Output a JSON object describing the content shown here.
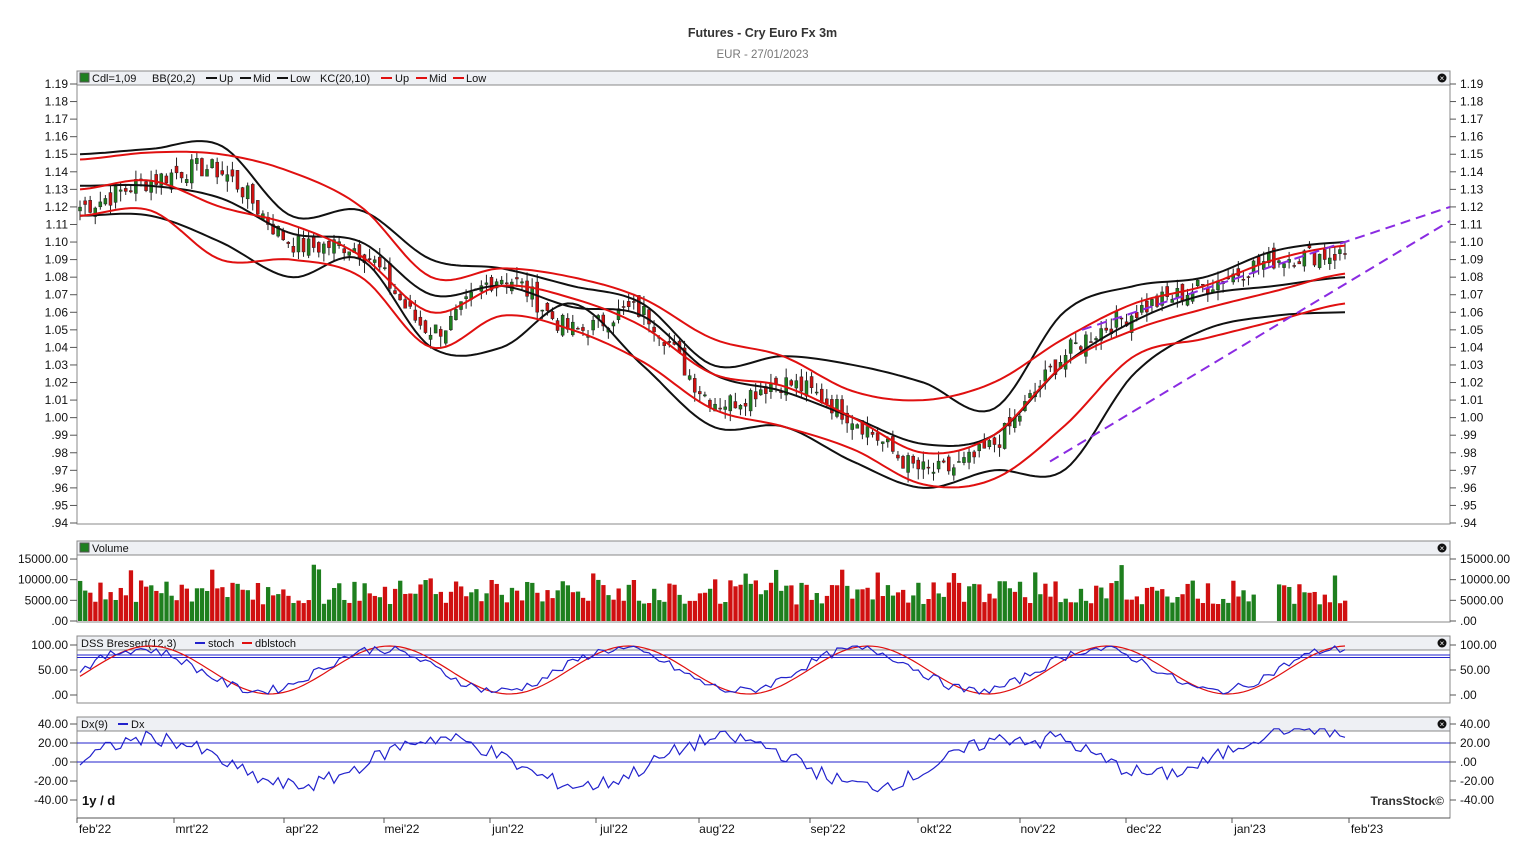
{
  "header": {
    "title": "Futures - Cry Euro Fx 3m",
    "subtitle": "EUR - 27/01/2023"
  },
  "footer": {
    "period": "1y / d",
    "brand": "TransStock©"
  },
  "x_axis": {
    "labels": [
      "feb'22",
      "mrt'22",
      "apr'22",
      "mei'22",
      "jun'22",
      "jul'22",
      "aug'22",
      "sep'22",
      "okt'22",
      "nov'22",
      "dec'22",
      "jan'23",
      "feb'23"
    ]
  },
  "panels": {
    "price": {
      "legend": {
        "cdl": "Cdl=1,09",
        "bb": "BB(20,2)",
        "bb_up": "Up",
        "bb_mid": "Mid",
        "bb_low": "Low",
        "kc": "KC(20,10)",
        "kc_up": "Up",
        "kc_mid": "Mid",
        "kc_low": "Low"
      },
      "ticks": [
        1.19,
        1.18,
        1.17,
        1.16,
        1.15,
        1.14,
        1.13,
        1.12,
        1.11,
        1.1,
        1.09,
        1.08,
        1.07,
        1.06,
        1.05,
        1.04,
        1.03,
        1.02,
        1.01,
        1.0,
        0.99,
        0.98,
        0.97,
        0.96,
        0.95,
        0.94
      ],
      "tick_labels": [
        "1.19",
        "1.18",
        "1.17",
        "1.16",
        "1.15",
        "1.14",
        "1.13",
        "1.12",
        "1.11",
        "1.10",
        "1.09",
        "1.08",
        "1.07",
        "1.06",
        "1.05",
        "1.04",
        "1.03",
        "1.02",
        "1.01",
        "1.00",
        ".99",
        ".98",
        ".97",
        ".96",
        ".95",
        ".94"
      ]
    },
    "volume": {
      "legend": "Volume",
      "ticks": [
        15000,
        10000,
        5000,
        0
      ],
      "tick_labels": [
        "15000.00",
        "10000.00",
        "5000.00",
        ".00"
      ]
    },
    "dss": {
      "legend": "DSS Bressert(12,3)",
      "stoch": "stoch",
      "dblstoch": "dblstoch",
      "ticks": [
        100,
        50,
        0
      ],
      "tick_labels": [
        "100.00",
        "50.00",
        ".00"
      ]
    },
    "dx": {
      "legend": "Dx(9)",
      "dx": "Dx",
      "ticks": [
        40,
        20,
        0,
        -20,
        -40
      ],
      "tick_labels": [
        "40.00",
        "20.00",
        ".00",
        "-20.00",
        "-40.00"
      ]
    }
  },
  "colors": {
    "up": "#1e7f1e",
    "down": "#d01010",
    "bb": "#111111",
    "kc": "#e01010",
    "trend": "#8a2be2",
    "stoch": "#2222cc",
    "dbl": "#e01010"
  },
  "chart_data": [
    {
      "type": "candlestick",
      "title": "Futures - Cry Euro Fx 3m",
      "subtitle": "EUR - 27/01/2023",
      "x": [
        "feb'22",
        "mrt'22",
        "apr'22",
        "mei'22",
        "jun'22",
        "jul'22",
        "aug'22",
        "sep'22",
        "okt'22",
        "nov'22",
        "dec'22",
        "jan'23"
      ],
      "close_path": [
        1.12,
        1.135,
        1.14,
        1.1,
        1.095,
        1.05,
        1.08,
        1.05,
        1.06,
        1.01,
        1.02,
        1.0,
        0.97,
        0.985,
        1.035,
        1.06,
        1.075,
        1.09,
        1.093
      ],
      "series": [
        {
          "name": "BB Up",
          "values": [
            1.15,
            1.153,
            1.155,
            1.115,
            1.118,
            1.09,
            1.085,
            1.075,
            1.065,
            1.03,
            1.035,
            1.03,
            1.02,
            1.005,
            1.06,
            1.075,
            1.08,
            1.095,
            1.1
          ]
        },
        {
          "name": "BB Mid",
          "values": [
            1.132,
            1.132,
            1.125,
            1.105,
            1.1,
            1.07,
            1.075,
            1.063,
            1.058,
            1.025,
            1.015,
            1.0,
            0.985,
            0.99,
            1.03,
            1.055,
            1.07,
            1.075,
            1.08
          ]
        },
        {
          "name": "BB Low",
          "values": [
            1.115,
            1.115,
            1.1,
            1.08,
            1.09,
            1.04,
            1.04,
            1.065,
            1.03,
            0.995,
            0.995,
            0.975,
            0.96,
            0.97,
            0.97,
            1.025,
            1.05,
            1.058,
            1.06
          ]
        },
        {
          "name": "KC Up",
          "values": [
            1.147,
            1.151,
            1.15,
            1.14,
            1.12,
            1.08,
            1.085,
            1.08,
            1.068,
            1.045,
            1.035,
            1.015,
            1.01,
            1.02,
            1.045,
            1.065,
            1.075,
            1.09,
            1.098
          ]
        },
        {
          "name": "KC Mid",
          "values": [
            1.13,
            1.135,
            1.12,
            1.11,
            1.092,
            1.06,
            1.075,
            1.068,
            1.052,
            1.025,
            1.018,
            1.0,
            0.98,
            0.99,
            1.03,
            1.05,
            1.062,
            1.072,
            1.082
          ]
        },
        {
          "name": "KC Low",
          "values": [
            1.115,
            1.118,
            1.09,
            1.09,
            1.08,
            1.04,
            1.058,
            1.05,
            1.032,
            1.005,
            0.995,
            0.982,
            0.962,
            0.965,
            0.995,
            1.035,
            1.045,
            1.055,
            1.065
          ]
        }
      ],
      "ylim": [
        0.94,
        1.19
      ],
      "last": "1,09"
    },
    {
      "type": "bar",
      "name": "Volume",
      "ylim": [
        0,
        15000
      ]
    },
    {
      "type": "line",
      "name": "DSS Bressert(12,3)",
      "series": [
        {
          "name": "stoch"
        },
        {
          "name": "dblstoch"
        }
      ],
      "levels": [
        75
      ],
      "ylim": [
        0,
        100
      ]
    },
    {
      "type": "line",
      "name": "Dx(9)",
      "series": [
        {
          "name": "Dx"
        }
      ],
      "levels": [
        20,
        0
      ],
      "ylim": [
        -40,
        40
      ]
    }
  ]
}
